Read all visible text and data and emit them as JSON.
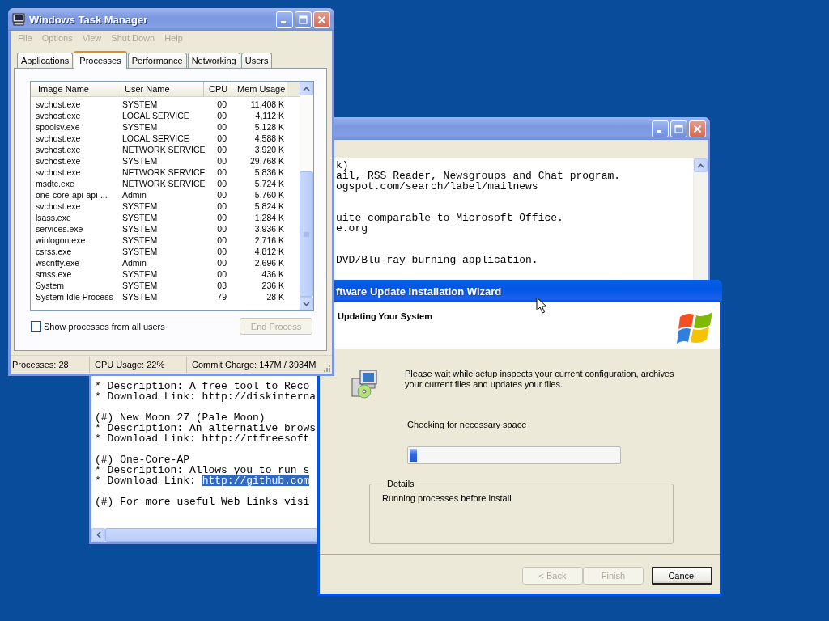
{
  "task_manager": {
    "title": "Windows Task Manager",
    "menu": [
      {
        "label": "File",
        "disabled": true
      },
      {
        "label": "Options",
        "disabled": true
      },
      {
        "label": "View",
        "disabled": true
      },
      {
        "label": "Shut Down",
        "disabled": true
      },
      {
        "label": "Help",
        "disabled": true
      }
    ],
    "tabs": [
      {
        "label": "Applications",
        "selected": false
      },
      {
        "label": "Processes",
        "selected": true
      },
      {
        "label": "Performance",
        "selected": false
      },
      {
        "label": "Networking",
        "selected": false
      },
      {
        "label": "Users",
        "selected": false
      }
    ],
    "columns": [
      "Image Name",
      "User Name",
      "CPU",
      "Mem Usage"
    ],
    "rows": [
      [
        "svchost.exe",
        "SYSTEM",
        "00",
        "11,408 K"
      ],
      [
        "svchost.exe",
        "LOCAL SERVICE",
        "00",
        "4,112 K"
      ],
      [
        "spoolsv.exe",
        "SYSTEM",
        "00",
        "5,128 K"
      ],
      [
        "svchost.exe",
        "LOCAL SERVICE",
        "00",
        "4,588 K"
      ],
      [
        "svchost.exe",
        "NETWORK SERVICE",
        "00",
        "3,920 K"
      ],
      [
        "svchost.exe",
        "SYSTEM",
        "00",
        "29,768 K"
      ],
      [
        "svchost.exe",
        "NETWORK SERVICE",
        "00",
        "5,836 K"
      ],
      [
        "msdtc.exe",
        "NETWORK SERVICE",
        "00",
        "5,724 K"
      ],
      [
        "one-core-api-api-...",
        "Admin",
        "00",
        "5,760 K"
      ],
      [
        "svchost.exe",
        "SYSTEM",
        "00",
        "5,824 K"
      ],
      [
        "lsass.exe",
        "SYSTEM",
        "00",
        "1,284 K"
      ],
      [
        "services.exe",
        "SYSTEM",
        "00",
        "3,936 K"
      ],
      [
        "winlogon.exe",
        "SYSTEM",
        "00",
        "2,716 K"
      ],
      [
        "csrss.exe",
        "SYSTEM",
        "00",
        "4,812 K"
      ],
      [
        "wscntfy.exe",
        "Admin",
        "00",
        "2,696 K"
      ],
      [
        "smss.exe",
        "SYSTEM",
        "00",
        "436 K"
      ],
      [
        "System",
        "SYSTEM",
        "03",
        "236 K"
      ],
      [
        "System Idle Process",
        "SYSTEM",
        "79",
        "28 K"
      ]
    ],
    "show_all_users": {
      "label": "Show processes from all users",
      "checked": false
    },
    "end_process": {
      "label": "End Process",
      "disabled": true
    },
    "status_bar": [
      "Processes: 28",
      "CPU Usage: 22%",
      "Commit Charge: 147M / 3934M"
    ]
  },
  "notepad": {
    "top_groups": [
      [
        "k)",
        "ail, RSS Reader, Newsgroups and Chat program.",
        "ogspot.com/search/label/mailnews"
      ],
      [
        "uite comparable to Microsoft Office.",
        "e.org"
      ],
      [
        "DVD/Blu-ray burning application."
      ]
    ],
    "bottom_groups": [
      [
        {
          "text": "* Description: A free tool to Reco"
        },
        {
          "text": "* Download Link: http://diskinterna"
        }
      ],
      [
        {
          "text": "(#) New Moon 27 (Pale Moon)"
        },
        {
          "text": "* Description: An alternative brows"
        },
        {
          "text": "* Download Link: http://rtfreesoft"
        }
      ],
      [
        {
          "text": "(#) One-Core-AP"
        },
        {
          "text": "* Description: Allows you to run s"
        },
        {
          "text": "* Download Link: ",
          "highlight": "http://github.com"
        }
      ],
      [
        {
          "text": "(#) For more useful Web Links visi"
        }
      ]
    ]
  },
  "wizard": {
    "title": "ftware Update Installation Wizard",
    "heading": "Updating Your System",
    "message": "Please wait while setup inspects your current configuration, archives your current files and updates your files.",
    "status": "Checking for necessary space",
    "progress": {
      "level": 0.035
    },
    "details": {
      "legend": "Details",
      "text": "Running processes before install"
    },
    "buttons": [
      {
        "label": "< Back",
        "disabled": true,
        "default": false
      },
      {
        "label": "Finish",
        "disabled": true,
        "default": false
      },
      {
        "label": "Cancel",
        "disabled": false,
        "default": true
      }
    ]
  }
}
